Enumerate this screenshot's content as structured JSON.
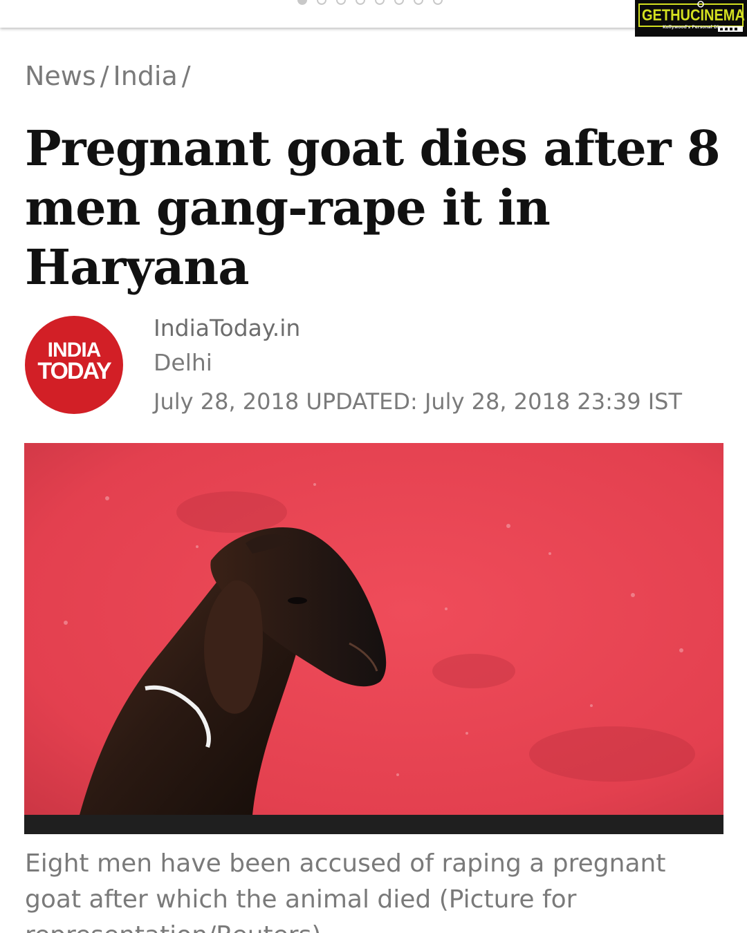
{
  "carousel": {
    "slide_count": 8,
    "active_index": 0
  },
  "watermark": {
    "brand": "GETHUCINEMA",
    "tagline": "Kollywood's Personal Diary"
  },
  "breadcrumb": {
    "items": [
      "News",
      "India"
    ],
    "separator": "/"
  },
  "article": {
    "headline_lines": [
      "Pregnant goat dies after 8",
      "men gang-rape it in",
      "Haryana"
    ],
    "source_logo": {
      "line1": "INDIA",
      "line2": "TODAY",
      "color": "#d21f26"
    },
    "source_name": "IndiaToday.in",
    "location": "Delhi",
    "dateline": "July 28, 2018 UPDATED: July 28, 2018 23:39 IST",
    "image": {
      "subject": "goat-photo",
      "background_color": "#e8424f"
    },
    "caption": "Eight men have been accused of raping a pregnant goat after which the animal died (Picture for representation/Reuters)"
  }
}
